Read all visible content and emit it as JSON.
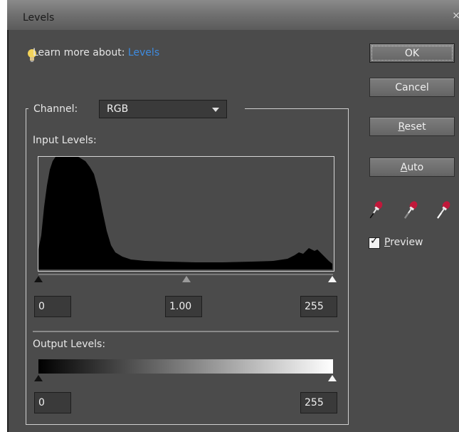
{
  "window": {
    "title": "Levels",
    "close_glyph": "×"
  },
  "learn": {
    "prefix": "Learn more about: ",
    "link": "Levels"
  },
  "buttons": {
    "ok": "OK",
    "cancel": "Cancel",
    "reset_first": "R",
    "reset_rest": "eset",
    "auto_first": "A",
    "auto_rest": "uto"
  },
  "channel": {
    "label": "Channel:",
    "value": "RGB"
  },
  "input": {
    "label": "Input Levels:",
    "black": "0",
    "gamma": "1.00",
    "white": "255"
  },
  "output": {
    "label": "Output Levels:",
    "black": "0",
    "white": "255"
  },
  "preview": {
    "first": "P",
    "rest": "review",
    "checked": true
  },
  "icons": [
    "lightbulb-icon",
    "eyedropper-black-icon",
    "eyedropper-gray-icon",
    "eyedropper-white-icon",
    "chevron-down-icon"
  ],
  "colors": {
    "panel": "#4b4b4b",
    "link": "#3e8be0",
    "eyedropper": "#c0183a"
  }
}
